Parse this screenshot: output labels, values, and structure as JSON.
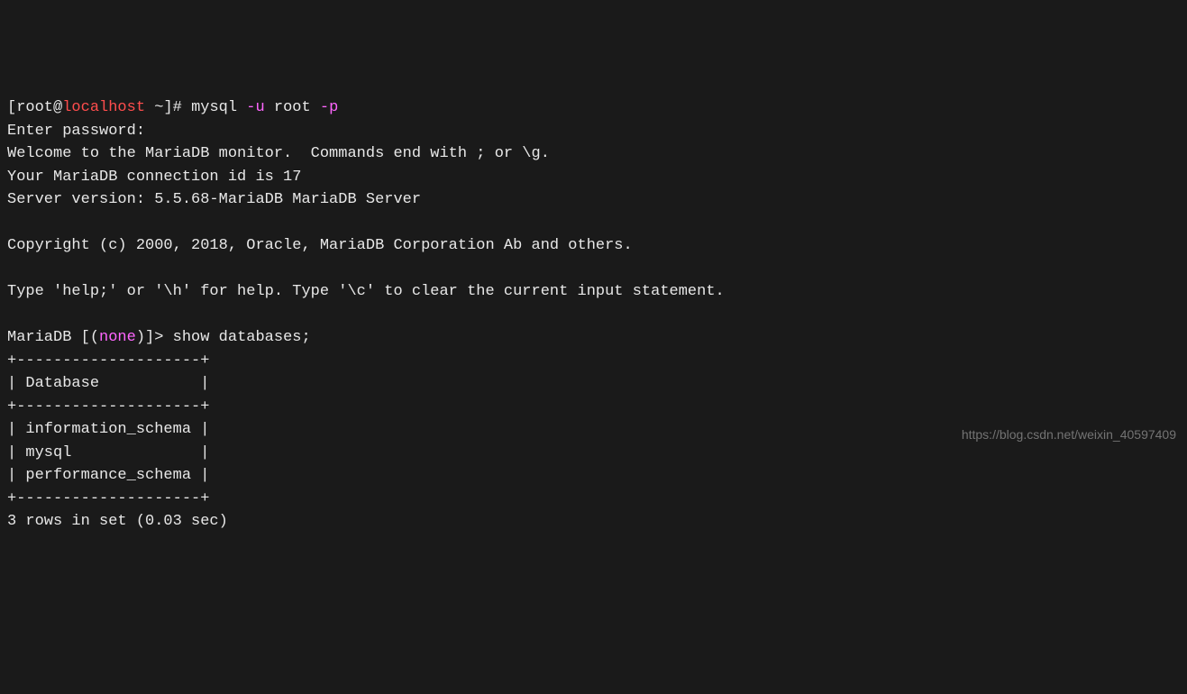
{
  "prompt1": {
    "bracket_open": "[",
    "user": "root",
    "at": "@",
    "host": "localhost",
    "path": " ~",
    "bracket_close": "]",
    "symbol": "# ",
    "cmd_plain1": "mysql ",
    "cmd_flag1": "-u",
    "cmd_plain2": " root ",
    "cmd_flag2": "-p"
  },
  "lines": {
    "enter_pw": "Enter password:",
    "welcome": "Welcome to the MariaDB monitor.  Commands end with ; or \\g.",
    "conn_id": "Your MariaDB connection id is 17",
    "server_ver": "Server version: 5.5.68-MariaDB MariaDB Server",
    "blank1": "",
    "copyright": "Copyright (c) 2000, 2018, Oracle, MariaDB Corporation Ab and others.",
    "blank2": "",
    "help": "Type 'help;' or '\\h' for help. Type '\\c' to clear the current input statement.",
    "blank3": ""
  },
  "prompt2": {
    "prefix": "MariaDB [(",
    "db": "none",
    "suffix": ")]> ",
    "cmd": "show databases;"
  },
  "table": {
    "border_top": "+--------------------+",
    "header": "| Database           |",
    "border_mid": "+--------------------+",
    "row1": "| information_schema |",
    "row2": "| mysql              |",
    "row3": "| performance_schema |",
    "border_bot": "+--------------------+"
  },
  "result": "3 rows in set (0.03 sec)",
  "watermark": "https://blog.csdn.net/weixin_40597409"
}
